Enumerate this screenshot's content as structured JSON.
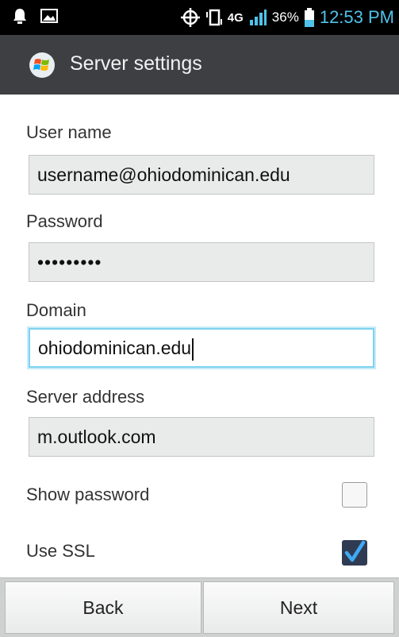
{
  "status_bar": {
    "battery_percent": "36%",
    "time": "12:53 PM",
    "network": "4G",
    "icons": [
      "notification-icon",
      "image-icon",
      "gps-icon",
      "vibrate-icon",
      "network-4g-icon",
      "signal-icon",
      "battery-icon"
    ]
  },
  "title_bar": {
    "title": "Server settings",
    "icon": "windows-logo-icon"
  },
  "form": {
    "username": {
      "label": "User name",
      "value": "username@ohiodominican.edu"
    },
    "password": {
      "label": "Password",
      "value": "•••••••••"
    },
    "domain": {
      "label": "Domain",
      "value": "ohiodominican.edu"
    },
    "server": {
      "label": "Server address",
      "value": "m.outlook.com"
    },
    "show_password": {
      "label": "Show password",
      "checked": false
    },
    "use_ssl": {
      "label": "Use SSL",
      "checked": true
    }
  },
  "buttons": {
    "back": "Back",
    "next": "Next"
  },
  "colors": {
    "status_bar": "#000000",
    "title_bar": "#3d3f43",
    "accent": "#4fc3ea",
    "field_bg": "#e9ebeb",
    "checkbox_checked": "#2f3b52"
  }
}
